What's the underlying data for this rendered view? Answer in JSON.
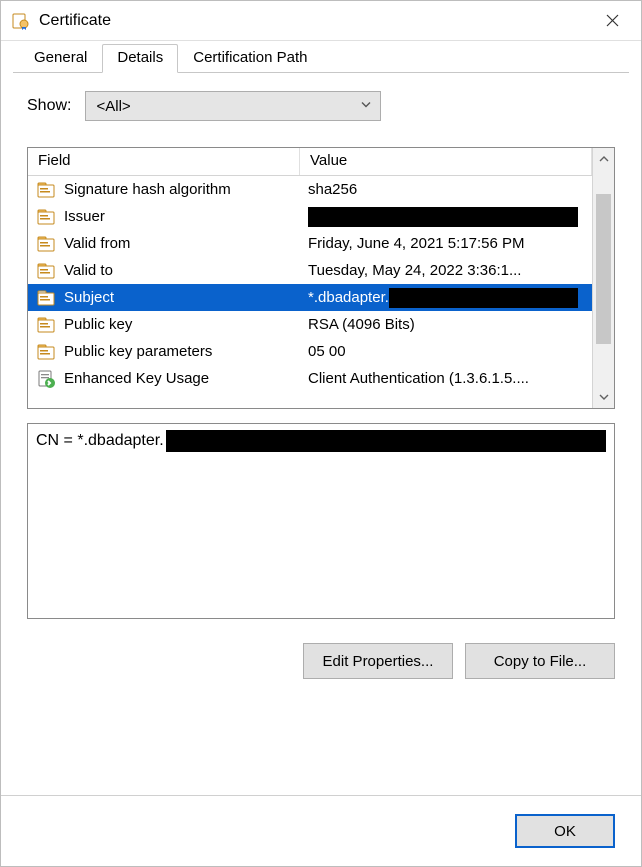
{
  "window": {
    "title": "Certificate"
  },
  "tabs": {
    "general": "General",
    "details": "Details",
    "certpath": "Certification Path",
    "active": "details"
  },
  "show": {
    "label": "Show:",
    "selected": "<All>"
  },
  "columns": {
    "field": "Field",
    "value": "Value"
  },
  "rows": [
    {
      "icon": "cert-field",
      "field": "Signature hash algorithm",
      "value": "sha256",
      "selected": false,
      "redactedValue": false
    },
    {
      "icon": "cert-field",
      "field": "Issuer",
      "value": "",
      "selected": false,
      "redactedValue": true
    },
    {
      "icon": "cert-field",
      "field": "Valid from",
      "value": "Friday, June 4, 2021 5:17:56 PM",
      "selected": false,
      "redactedValue": false
    },
    {
      "icon": "cert-field",
      "field": "Valid to",
      "value": "Tuesday, May 24, 2022 3:36:1...",
      "selected": false,
      "redactedValue": false
    },
    {
      "icon": "cert-field",
      "field": "Subject",
      "value": "*.dbadapter.",
      "selected": true,
      "redactedValue": "after"
    },
    {
      "icon": "cert-field",
      "field": "Public key",
      "value": "RSA (4096 Bits)",
      "selected": false,
      "redactedValue": false
    },
    {
      "icon": "cert-field",
      "field": "Public key parameters",
      "value": "05 00",
      "selected": false,
      "redactedValue": false
    },
    {
      "icon": "ext",
      "field": "Enhanced Key Usage",
      "value": "Client Authentication (1.3.6.1.5....",
      "selected": false,
      "redactedValue": false
    }
  ],
  "detail": {
    "text": "CN = *.dbadapter."
  },
  "buttons": {
    "editProperties": "Edit Properties...",
    "copyToFile": "Copy to File...",
    "ok": "OK"
  }
}
